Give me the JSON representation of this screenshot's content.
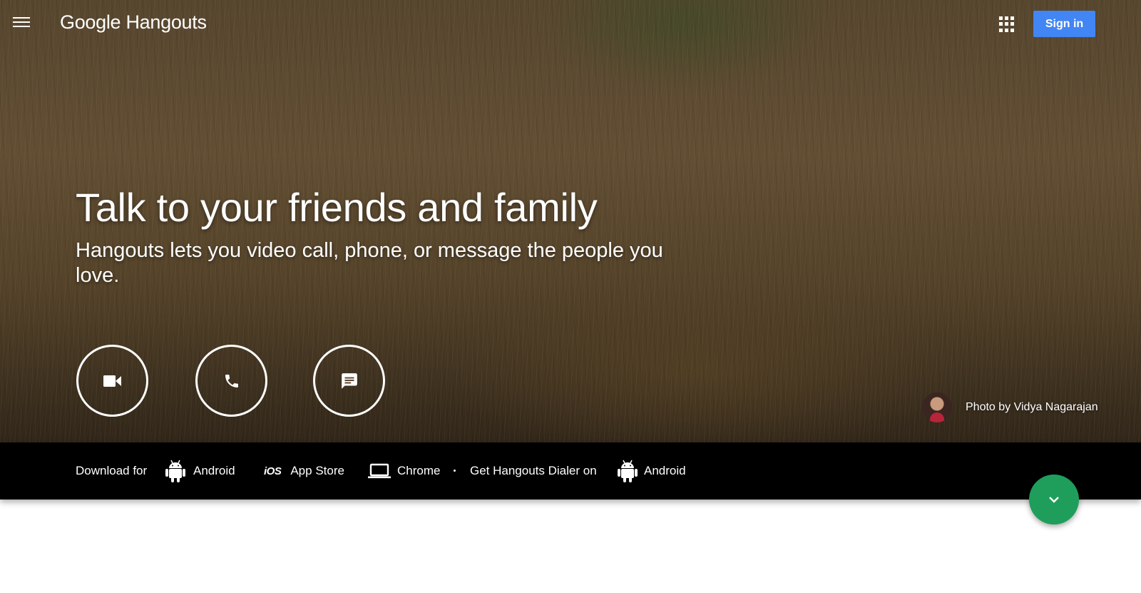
{
  "header": {
    "logo_google": "Google",
    "logo_product": "Hangouts",
    "signin_label": "Sign in"
  },
  "hero": {
    "headline": "Talk to your friends and family",
    "subheadline": "Hangouts lets you video call, phone, or message the people you love.",
    "actions": [
      {
        "icon": "video-camera-icon"
      },
      {
        "icon": "phone-icon"
      },
      {
        "icon": "message-icon"
      }
    ],
    "photo_credit": "Photo by Vidya Nagarajan"
  },
  "download_bar": {
    "prefix": "Download for",
    "android_label": "Android",
    "ios_badge": "iOS",
    "appstore_label": "App Store",
    "chrome_label": "Chrome",
    "dialer_prefix": "Get Hangouts Dialer on",
    "dialer_android_label": "Android"
  },
  "colors": {
    "signin_bg": "#4285f4",
    "fab_bg": "#1e9e5a",
    "bar_bg": "#000000"
  }
}
